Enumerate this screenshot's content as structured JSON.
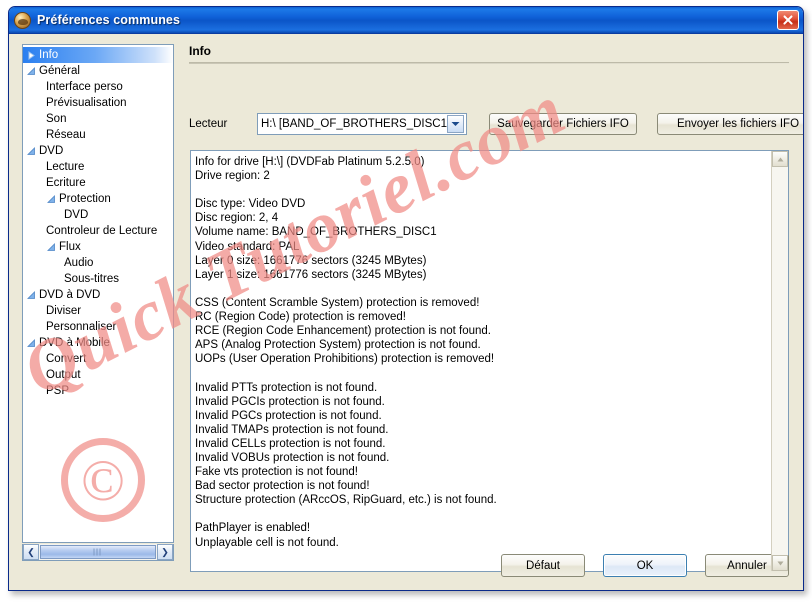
{
  "window": {
    "title": "Préférences communes",
    "icon": "app-icon",
    "close_label": "×"
  },
  "sidebar": {
    "items": [
      {
        "label": "Info",
        "level": 0,
        "state": "collapsed",
        "selected": true
      },
      {
        "label": "Général",
        "level": 0,
        "state": "expanded",
        "selected": false
      },
      {
        "label": "Interface perso",
        "level": 1,
        "state": "leaf",
        "selected": false
      },
      {
        "label": "Prévisualisation",
        "level": 1,
        "state": "leaf",
        "selected": false
      },
      {
        "label": "Son",
        "level": 1,
        "state": "leaf",
        "selected": false
      },
      {
        "label": "Réseau",
        "level": 1,
        "state": "leaf",
        "selected": false
      },
      {
        "label": "DVD",
        "level": 0,
        "state": "expanded",
        "selected": false
      },
      {
        "label": "Lecture",
        "level": 1,
        "state": "leaf",
        "selected": false
      },
      {
        "label": "Ecriture",
        "level": 1,
        "state": "leaf",
        "selected": false
      },
      {
        "label": "Protection",
        "level": 1,
        "state": "expanded",
        "selected": false
      },
      {
        "label": "DVD",
        "level": 2,
        "state": "leaf",
        "selected": false
      },
      {
        "label": "Controleur de Lecture",
        "level": 1,
        "state": "leaf",
        "selected": false
      },
      {
        "label": "Flux",
        "level": 1,
        "state": "expanded",
        "selected": false
      },
      {
        "label": "Audio",
        "level": 2,
        "state": "leaf",
        "selected": false
      },
      {
        "label": "Sous-titres",
        "level": 2,
        "state": "leaf",
        "selected": false
      },
      {
        "label": "DVD à DVD",
        "level": 0,
        "state": "expanded",
        "selected": false
      },
      {
        "label": "Diviser",
        "level": 1,
        "state": "leaf",
        "selected": false
      },
      {
        "label": "Personnaliser",
        "level": 1,
        "state": "leaf",
        "selected": false
      },
      {
        "label": "DVD à Mobile",
        "level": 0,
        "state": "expanded",
        "selected": false
      },
      {
        "label": "Convert",
        "level": 1,
        "state": "leaf",
        "selected": false
      },
      {
        "label": "Output",
        "level": 1,
        "state": "leaf",
        "selected": false
      },
      {
        "label": "PSP",
        "level": 1,
        "state": "leaf",
        "selected": false
      }
    ],
    "hscroll": {
      "left_arrow": "❮",
      "right_arrow": "❯"
    }
  },
  "pane": {
    "title": "Info",
    "drive_label": "Lecteur",
    "drive_value": "H:\\ [BAND_OF_BROTHERS_DISC1]",
    "drive_arrow": "▼",
    "save_ifo_label": "Sauvegarder Fichiers IFO",
    "send_ifo_label": "Envoyer les fichiers IFO"
  },
  "info_text": "Info for drive [H:\\] (DVDFab Platinum 5.2.5.0)\nDrive region: 2\n\nDisc type: Video DVD\nDisc region: 2, 4\nVolume name: BAND_OF_BROTHERS_DISC1\nVideo standard: PAL\nLayer 0 size: 1661776 sectors (3245 MBytes)\nLayer 1 size: 1661776 sectors (3245 MBytes)\n\nCSS (Content Scramble System) protection is removed!\nRC (Region Code) protection is removed!\nRCE (Region Code Enhancement) protection is not found.\nAPS (Analog Protection System) protection is not found.\nUOPs (User Operation Prohibitions) protection is removed!\n\nInvalid PTTs protection is not found.\nInvalid PGCIs protection is not found.\nInvalid PGCs protection is not found.\nInvalid TMAPs protection is not found.\nInvalid CELLs protection is not found.\nInvalid VOBUs protection is not found.\nFake vts protection is not found!\nBad sector protection is not found!\nStructure protection (ARccOS, RipGuard, etc.) is not found.\n\nPathPlayer is enabled!\nUnplayable cell is not found.",
  "info_scroll": {
    "up_arrow": "▲",
    "down_arrow": "▼"
  },
  "watermark": {
    "text": "Quick Tutoriel.com",
    "copyright_symbol": "©",
    "color": "#f08b86"
  },
  "footer": {
    "default_label": "Défaut",
    "ok_label": "OK",
    "cancel_label": "Annuler"
  },
  "colors": {
    "dialog_bg": "#ece9d8",
    "titlebar_blue": "#0b5fd0",
    "selection_blue": "#2a7ff0",
    "field_border": "#7f9db9"
  }
}
